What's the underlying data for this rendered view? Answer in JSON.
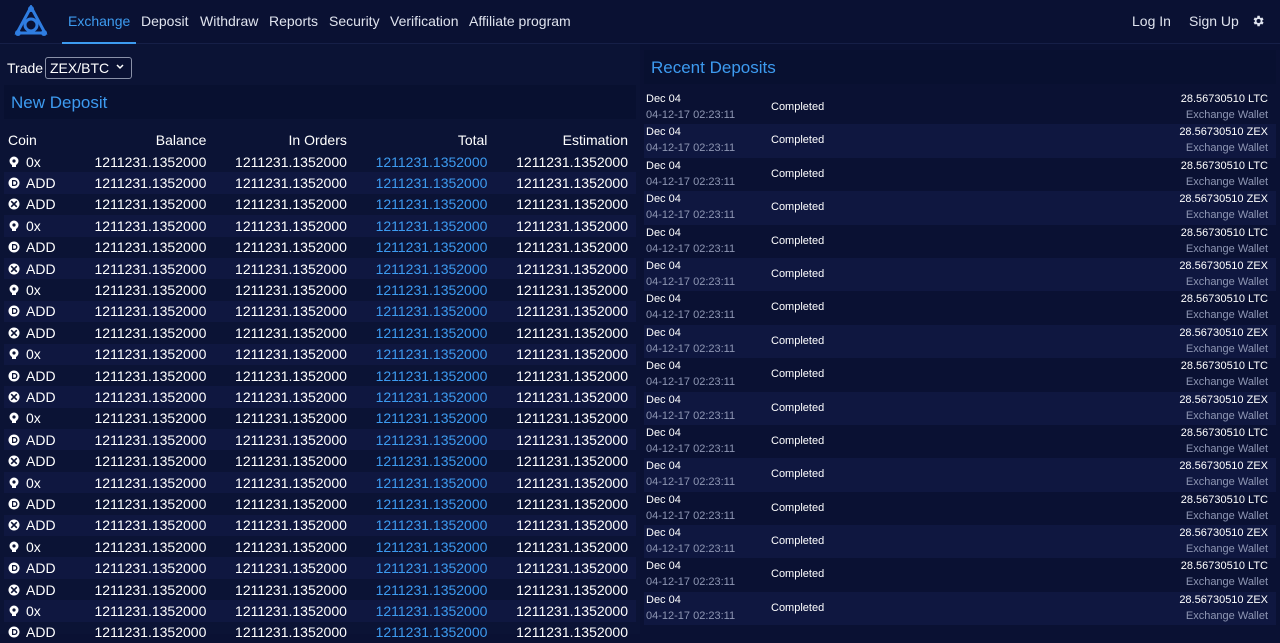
{
  "nav": {
    "items": [
      "Exchange",
      "Deposit",
      "Withdraw",
      "Reports",
      "Security",
      "Verification",
      "Affiliate program"
    ],
    "active": "Exchange",
    "login": "Log In",
    "signup": "Sign Up",
    "settings_icon": "gear-icon",
    "logo_icon": "brand-logo-icon"
  },
  "trade": {
    "label": "Trade",
    "pair": "ZEX/BTC"
  },
  "left_panel": {
    "title": "New Deposit"
  },
  "table": {
    "headers": [
      "Coin",
      "Balance",
      "In Orders",
      "Total",
      "Estimation"
    ],
    "rows": [
      {
        "icon": "coin-0x-icon",
        "coin": "0x",
        "balance": "1211231.1352000",
        "in_orders": "1211231.1352000",
        "total": "1211231.1352000",
        "estimation": "1211231.1352000"
      },
      {
        "icon": "coin-add-icon",
        "coin": "ADD",
        "balance": "1211231.1352000",
        "in_orders": "1211231.1352000",
        "total": "1211231.1352000",
        "estimation": "1211231.1352000"
      },
      {
        "icon": "coin-x-icon",
        "coin": "ADD",
        "balance": "1211231.1352000",
        "in_orders": "1211231.1352000",
        "total": "1211231.1352000",
        "estimation": "1211231.1352000"
      },
      {
        "icon": "coin-0x-icon",
        "coin": "0x",
        "balance": "1211231.1352000",
        "in_orders": "1211231.1352000",
        "total": "1211231.1352000",
        "estimation": "1211231.1352000"
      },
      {
        "icon": "coin-add-icon",
        "coin": "ADD",
        "balance": "1211231.1352000",
        "in_orders": "1211231.1352000",
        "total": "1211231.1352000",
        "estimation": "1211231.1352000"
      },
      {
        "icon": "coin-x-icon",
        "coin": "ADD",
        "balance": "1211231.1352000",
        "in_orders": "1211231.1352000",
        "total": "1211231.1352000",
        "estimation": "1211231.1352000"
      },
      {
        "icon": "coin-0x-icon",
        "coin": "0x",
        "balance": "1211231.1352000",
        "in_orders": "1211231.1352000",
        "total": "1211231.1352000",
        "estimation": "1211231.1352000"
      },
      {
        "icon": "coin-add-icon",
        "coin": "ADD",
        "balance": "1211231.1352000",
        "in_orders": "1211231.1352000",
        "total": "1211231.1352000",
        "estimation": "1211231.1352000"
      },
      {
        "icon": "coin-x-icon",
        "coin": "ADD",
        "balance": "1211231.1352000",
        "in_orders": "1211231.1352000",
        "total": "1211231.1352000",
        "estimation": "1211231.1352000"
      },
      {
        "icon": "coin-0x-icon",
        "coin": "0x",
        "balance": "1211231.1352000",
        "in_orders": "1211231.1352000",
        "total": "1211231.1352000",
        "estimation": "1211231.1352000"
      },
      {
        "icon": "coin-add-icon",
        "coin": "ADD",
        "balance": "1211231.1352000",
        "in_orders": "1211231.1352000",
        "total": "1211231.1352000",
        "estimation": "1211231.1352000"
      },
      {
        "icon": "coin-x-icon",
        "coin": "ADD",
        "balance": "1211231.1352000",
        "in_orders": "1211231.1352000",
        "total": "1211231.1352000",
        "estimation": "1211231.1352000"
      },
      {
        "icon": "coin-0x-icon",
        "coin": "0x",
        "balance": "1211231.1352000",
        "in_orders": "1211231.1352000",
        "total": "1211231.1352000",
        "estimation": "1211231.1352000"
      },
      {
        "icon": "coin-add-icon",
        "coin": "ADD",
        "balance": "1211231.1352000",
        "in_orders": "1211231.1352000",
        "total": "1211231.1352000",
        "estimation": "1211231.1352000"
      },
      {
        "icon": "coin-x-icon",
        "coin": "ADD",
        "balance": "1211231.1352000",
        "in_orders": "1211231.1352000",
        "total": "1211231.1352000",
        "estimation": "1211231.1352000"
      },
      {
        "icon": "coin-0x-icon",
        "coin": "0x",
        "balance": "1211231.1352000",
        "in_orders": "1211231.1352000",
        "total": "1211231.1352000",
        "estimation": "1211231.1352000"
      },
      {
        "icon": "coin-add-icon",
        "coin": "ADD",
        "balance": "1211231.1352000",
        "in_orders": "1211231.1352000",
        "total": "1211231.1352000",
        "estimation": "1211231.1352000"
      },
      {
        "icon": "coin-x-icon",
        "coin": "ADD",
        "balance": "1211231.1352000",
        "in_orders": "1211231.1352000",
        "total": "1211231.1352000",
        "estimation": "1211231.1352000"
      },
      {
        "icon": "coin-0x-icon",
        "coin": "0x",
        "balance": "1211231.1352000",
        "in_orders": "1211231.1352000",
        "total": "1211231.1352000",
        "estimation": "1211231.1352000"
      },
      {
        "icon": "coin-add-icon",
        "coin": "ADD",
        "balance": "1211231.1352000",
        "in_orders": "1211231.1352000",
        "total": "1211231.1352000",
        "estimation": "1211231.1352000"
      },
      {
        "icon": "coin-x-icon",
        "coin": "ADD",
        "balance": "1211231.1352000",
        "in_orders": "1211231.1352000",
        "total": "1211231.1352000",
        "estimation": "1211231.1352000"
      },
      {
        "icon": "coin-0x-icon",
        "coin": "0x",
        "balance": "1211231.1352000",
        "in_orders": "1211231.1352000",
        "total": "1211231.1352000",
        "estimation": "1211231.1352000"
      },
      {
        "icon": "coin-add-icon",
        "coin": "ADD",
        "balance": "1211231.1352000",
        "in_orders": "1211231.1352000",
        "total": "1211231.1352000",
        "estimation": "1211231.1352000"
      }
    ]
  },
  "right_panel": {
    "title": "Recent Deposits"
  },
  "deposits": [
    {
      "date": "Dec 04",
      "time": "04-12-17 02:23:11",
      "status": "Completed",
      "amount": "28.56730510 LTC",
      "wallet": "Exchange Wallet"
    },
    {
      "date": "Dec 04",
      "time": "04-12-17 02:23:11",
      "status": "Completed",
      "amount": "28.56730510 ZEX",
      "wallet": "Exchange Wallet"
    },
    {
      "date": "Dec 04",
      "time": "04-12-17 02:23:11",
      "status": "Completed",
      "amount": "28.56730510 LTC",
      "wallet": "Exchange Wallet"
    },
    {
      "date": "Dec 04",
      "time": "04-12-17 02:23:11",
      "status": "Completed",
      "amount": "28.56730510 ZEX",
      "wallet": "Exchange Wallet"
    },
    {
      "date": "Dec 04",
      "time": "04-12-17 02:23:11",
      "status": "Completed",
      "amount": "28.56730510 LTC",
      "wallet": "Exchange Wallet"
    },
    {
      "date": "Dec 04",
      "time": "04-12-17 02:23:11",
      "status": "Completed",
      "amount": "28.56730510 ZEX",
      "wallet": "Exchange Wallet"
    },
    {
      "date": "Dec 04",
      "time": "04-12-17 02:23:11",
      "status": "Completed",
      "amount": "28.56730510 LTC",
      "wallet": "Exchange Wallet"
    },
    {
      "date": "Dec 04",
      "time": "04-12-17 02:23:11",
      "status": "Completed",
      "amount": "28.56730510 ZEX",
      "wallet": "Exchange Wallet"
    },
    {
      "date": "Dec 04",
      "time": "04-12-17 02:23:11",
      "status": "Completed",
      "amount": "28.56730510 LTC",
      "wallet": "Exchange Wallet"
    },
    {
      "date": "Dec 04",
      "time": "04-12-17 02:23:11",
      "status": "Completed",
      "amount": "28.56730510 ZEX",
      "wallet": "Exchange Wallet"
    },
    {
      "date": "Dec 04",
      "time": "04-12-17 02:23:11",
      "status": "Completed",
      "amount": "28.56730510 LTC",
      "wallet": "Exchange Wallet"
    },
    {
      "date": "Dec 04",
      "time": "04-12-17 02:23:11",
      "status": "Completed",
      "amount": "28.56730510 ZEX",
      "wallet": "Exchange Wallet"
    },
    {
      "date": "Dec 04",
      "time": "04-12-17 02:23:11",
      "status": "Completed",
      "amount": "28.56730510 LTC",
      "wallet": "Exchange Wallet"
    },
    {
      "date": "Dec 04",
      "time": "04-12-17 02:23:11",
      "status": "Completed",
      "amount": "28.56730510 ZEX",
      "wallet": "Exchange Wallet"
    },
    {
      "date": "Dec 04",
      "time": "04-12-17 02:23:11",
      "status": "Completed",
      "amount": "28.56730510 LTC",
      "wallet": "Exchange Wallet"
    },
    {
      "date": "Dec 04",
      "time": "04-12-17 02:23:11",
      "status": "Completed",
      "amount": "28.56730510 ZEX",
      "wallet": "Exchange Wallet"
    }
  ],
  "colors": {
    "accent": "#3d9bf0",
    "background": "#0a1133",
    "row_alt": "#0f1740"
  }
}
